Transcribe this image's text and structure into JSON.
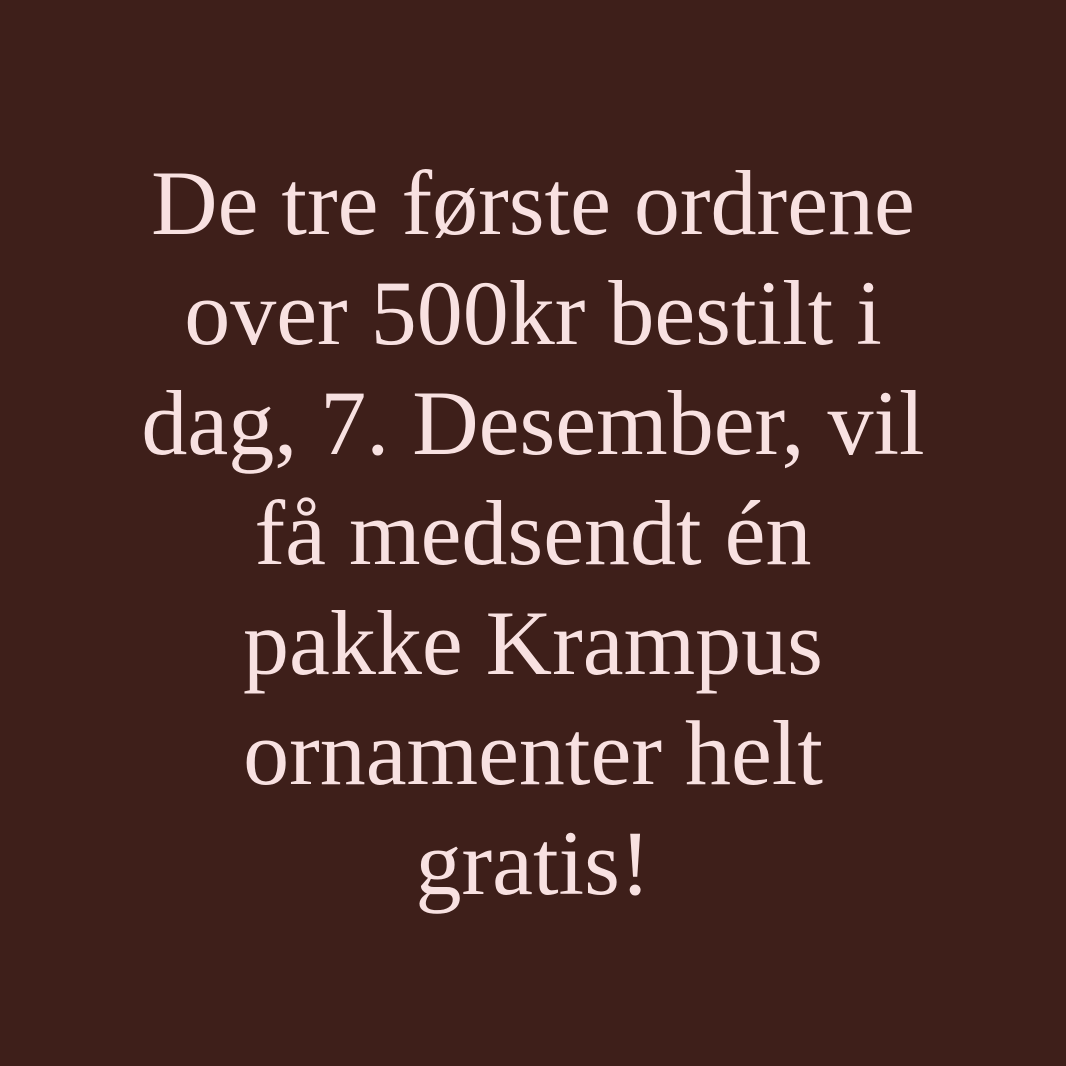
{
  "colors": {
    "background": "#3e1f1a",
    "text": "#f8e1e1"
  },
  "message": {
    "lines": [
      "De tre første ordrene",
      "over 500kr bestilt i",
      "dag, 7. Desember, vil",
      "få medsendt én",
      "pakke Krampus",
      "ornamenter helt",
      "gratis!"
    ]
  }
}
